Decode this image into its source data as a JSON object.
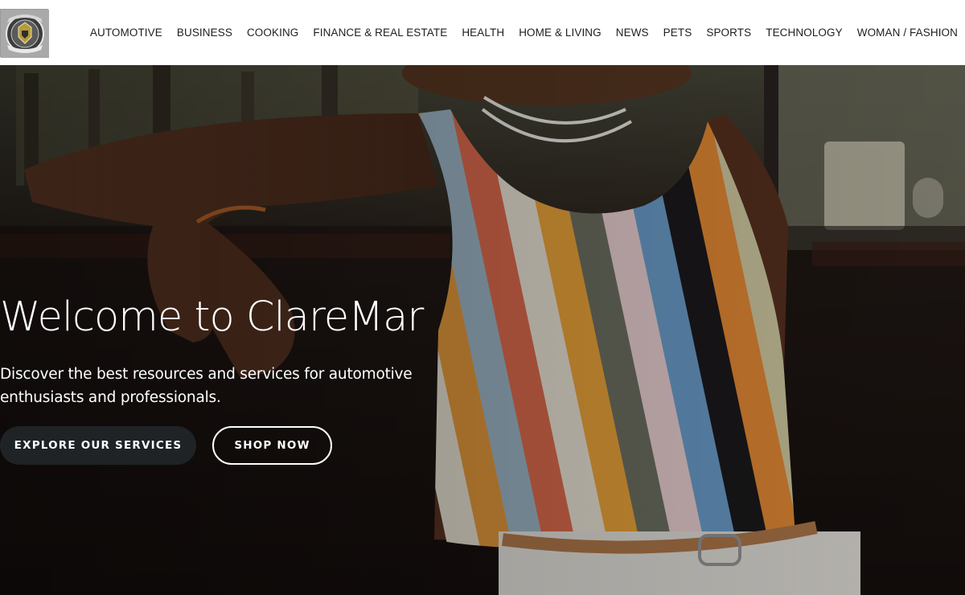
{
  "header": {
    "logo_alt": "ClareMar logo",
    "nav": [
      {
        "label": "AUTOMOTIVE"
      },
      {
        "label": "BUSINESS"
      },
      {
        "label": "COOKING"
      },
      {
        "label": "FINANCE & REAL ESTATE"
      },
      {
        "label": "HEALTH"
      },
      {
        "label": "HOME & LIVING"
      },
      {
        "label": "NEWS"
      },
      {
        "label": "PETS"
      },
      {
        "label": "SPORTS"
      },
      {
        "label": "TECHNOLOGY"
      },
      {
        "label": "WOMAN / FASHION"
      }
    ]
  },
  "hero": {
    "title": "Welcome to ClareMar",
    "subtitle": "Discover the best resources and services for automotive enthusiasts and professionals.",
    "primary_button": "EXPLORE OUR SERVICES",
    "secondary_button": "SHOP NOW",
    "image_alt": "Woman in a striped tank top leaning on a vintage car door"
  },
  "colors": {
    "header_bg": "#ffffff",
    "nav_text": "#1f1f1f",
    "hero_text": "#ffffff",
    "primary_button_bg": "#1f2326"
  }
}
